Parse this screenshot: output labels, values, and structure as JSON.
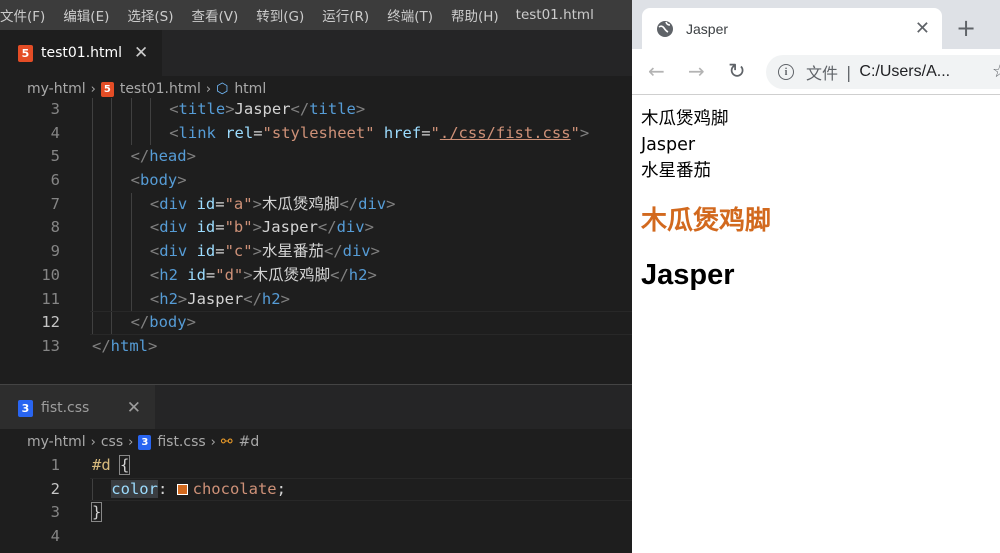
{
  "menubar": {
    "items": [
      "文件(F)",
      "编辑(E)",
      "选择(S)",
      "查看(V)",
      "转到(G)",
      "运行(R)",
      "终端(T)",
      "帮助(H)"
    ],
    "window_title": "test01.html"
  },
  "editor_top": {
    "tab": {
      "icon": "html-file-icon",
      "label": "test01.html"
    },
    "breadcrumb": [
      "my-html",
      "test01.html",
      "html"
    ],
    "lines": [
      {
        "n": "3",
        "tokens": [
          [
            "tok-br",
            "<"
          ],
          [
            "tok-tag",
            "title"
          ],
          [
            "tok-br",
            ">"
          ],
          [
            "tok-text",
            "Jasper"
          ],
          [
            "tok-br",
            "</"
          ],
          [
            "tok-tag",
            "title"
          ],
          [
            "tok-br",
            ">"
          ]
        ],
        "indent": 4
      },
      {
        "n": "4",
        "tokens": [
          [
            "tok-br",
            "<"
          ],
          [
            "tok-tag",
            "link "
          ],
          [
            "tok-attr",
            "rel"
          ],
          [
            "tok-eq",
            "="
          ],
          [
            "tok-str",
            "\"stylesheet\" "
          ],
          [
            "tok-attr",
            "href"
          ],
          [
            "tok-eq",
            "="
          ],
          [
            "tok-str",
            "\""
          ],
          [
            "tok-str tok-link",
            "./css/fist.css"
          ],
          [
            "tok-str",
            "\""
          ],
          [
            "tok-br",
            ">"
          ]
        ],
        "indent": 4
      },
      {
        "n": "5",
        "tokens": [
          [
            "tok-br",
            "</"
          ],
          [
            "tok-tag",
            "head"
          ],
          [
            "tok-br",
            ">"
          ]
        ],
        "indent": 2
      },
      {
        "n": "6",
        "tokens": [
          [
            "tok-br",
            "<"
          ],
          [
            "tok-tag",
            "body"
          ],
          [
            "tok-br",
            ">"
          ]
        ],
        "indent": 2
      },
      {
        "n": "7",
        "tokens": [
          [
            "tok-br",
            "<"
          ],
          [
            "tok-tag",
            "div "
          ],
          [
            "tok-attr",
            "id"
          ],
          [
            "tok-eq",
            "="
          ],
          [
            "tok-str",
            "\"a\""
          ],
          [
            "tok-br",
            ">"
          ],
          [
            "tok-text",
            "木瓜煲鸡脚"
          ],
          [
            "tok-br",
            "</"
          ],
          [
            "tok-tag",
            "div"
          ],
          [
            "tok-br",
            ">"
          ]
        ],
        "indent": 3
      },
      {
        "n": "8",
        "tokens": [
          [
            "tok-br",
            "<"
          ],
          [
            "tok-tag",
            "div "
          ],
          [
            "tok-attr",
            "id"
          ],
          [
            "tok-eq",
            "="
          ],
          [
            "tok-str",
            "\"b\""
          ],
          [
            "tok-br",
            ">"
          ],
          [
            "tok-text",
            "Jasper"
          ],
          [
            "tok-br",
            "</"
          ],
          [
            "tok-tag",
            "div"
          ],
          [
            "tok-br",
            ">"
          ]
        ],
        "indent": 3
      },
      {
        "n": "9",
        "tokens": [
          [
            "tok-br",
            "<"
          ],
          [
            "tok-tag",
            "div "
          ],
          [
            "tok-attr",
            "id"
          ],
          [
            "tok-eq",
            "="
          ],
          [
            "tok-str",
            "\"c\""
          ],
          [
            "tok-br",
            ">"
          ],
          [
            "tok-text",
            "水星番茄"
          ],
          [
            "tok-br",
            "</"
          ],
          [
            "tok-tag",
            "div"
          ],
          [
            "tok-br",
            ">"
          ]
        ],
        "indent": 3
      },
      {
        "n": "10",
        "tokens": [
          [
            "tok-br",
            "<"
          ],
          [
            "tok-tag",
            "h2 "
          ],
          [
            "tok-attr",
            "id"
          ],
          [
            "tok-eq",
            "="
          ],
          [
            "tok-str",
            "\"d\""
          ],
          [
            "tok-br",
            ">"
          ],
          [
            "tok-text",
            "木瓜煲鸡脚"
          ],
          [
            "tok-br",
            "</"
          ],
          [
            "tok-tag",
            "h2"
          ],
          [
            "tok-br",
            ">"
          ]
        ],
        "indent": 3
      },
      {
        "n": "11",
        "tokens": [
          [
            "tok-br",
            "<"
          ],
          [
            "tok-tag",
            "h2"
          ],
          [
            "tok-br",
            ">"
          ],
          [
            "tok-text",
            "Jasper"
          ],
          [
            "tok-br",
            "</"
          ],
          [
            "tok-tag",
            "h2"
          ],
          [
            "tok-br",
            ">"
          ]
        ],
        "indent": 3
      },
      {
        "n": "12",
        "tokens": [
          [
            "tok-br",
            "</"
          ],
          [
            "tok-tag",
            "body"
          ],
          [
            "tok-br",
            ">"
          ]
        ],
        "indent": 2,
        "current": true
      },
      {
        "n": "13",
        "tokens": [
          [
            "tok-br",
            "</"
          ],
          [
            "tok-tag",
            "html"
          ],
          [
            "tok-br",
            ">"
          ]
        ],
        "indent": 0
      }
    ]
  },
  "editor_bottom": {
    "tab": {
      "icon": "css-file-icon",
      "label": "fist.css"
    },
    "breadcrumb": [
      "my-html",
      "css",
      "fist.css",
      "#d"
    ],
    "lines": [
      {
        "n": "1",
        "tokens": [
          [
            "tok-sel",
            "#d "
          ],
          [
            "tok-punc bracket-box",
            "{"
          ]
        ],
        "indent": 0
      },
      {
        "n": "2",
        "tokens": [
          [
            "tok-prop",
            "color"
          ],
          [
            "tok-punc",
            ": "
          ],
          [
            "swatch",
            "#d2691e"
          ],
          [
            "tok-val",
            "chocolate"
          ],
          [
            "tok-punc",
            ";"
          ]
        ],
        "indent": 1,
        "current": true
      },
      {
        "n": "3",
        "tokens": [
          [
            "tok-punc bracket-box",
            "}"
          ]
        ],
        "indent": 0
      },
      {
        "n": "4",
        "tokens": [],
        "indent": 0
      }
    ]
  },
  "browser": {
    "tab_title": "Jasper",
    "new_tab_glyph": "+",
    "close_glyph": "✕",
    "nav": {
      "back": "←",
      "forward": "→",
      "reload": "↻"
    },
    "omnibox": {
      "info": "i",
      "scheme": "文件",
      "divider": "|",
      "url": "C:/Users/A..."
    },
    "star": "☆",
    "page": {
      "divs": [
        "木瓜煲鸡脚",
        "Jasper",
        "水星番茄"
      ],
      "h2_colored": "木瓜煲鸡脚",
      "h2_plain": "Jasper",
      "h2_color": "#d2691e"
    }
  }
}
